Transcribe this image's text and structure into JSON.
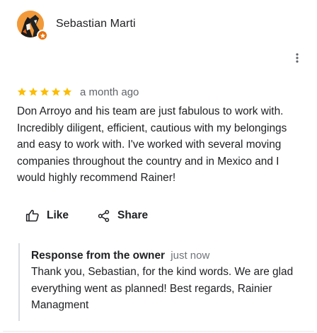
{
  "reviewer": {
    "name": "Sebastian Marti",
    "avatar_icon": "profile-photo",
    "badge_icon": "local-guide-star-icon",
    "badge_color": "#e8710a"
  },
  "menu": {
    "icon": "more-vertical-icon"
  },
  "rating": {
    "stars": 5,
    "max_stars": 5,
    "star_color": "#fbbc04"
  },
  "review": {
    "date": "a month ago",
    "text": "Don Arroyo and his team are just fabulous to work with. Incredibly diligent, efficient, cautious with my belongings and easy to work with. I've worked with several moving companies throughout the country and in Mexico and I would highly recommend Rainer!"
  },
  "actions": {
    "like_label": "Like",
    "like_icon": "thumbs-up-icon",
    "share_label": "Share",
    "share_icon": "share-icon"
  },
  "owner_response": {
    "title": "Response from the owner",
    "date": "just now",
    "text": "Thank you, Sebastian, for the kind words. We are glad everything went as planned! Best regards, Rainier Managment"
  }
}
